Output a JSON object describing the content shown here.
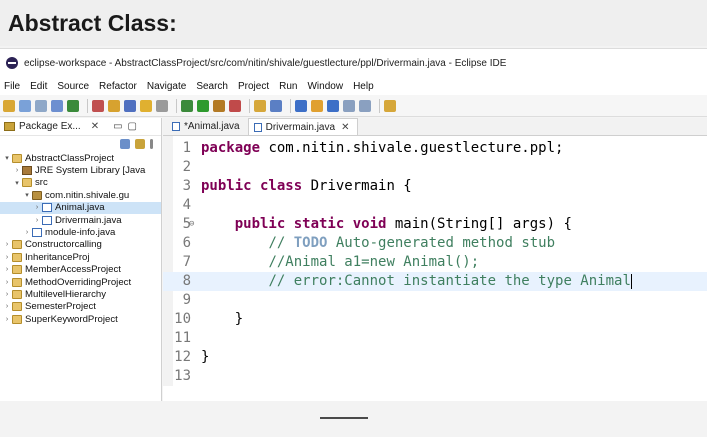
{
  "slide": {
    "title": "Abstract Class:"
  },
  "window": {
    "title": "eclipse-workspace - AbstractClassProject/src/com/nitin/shivale/guestlecture/ppl/Drivermain.java - Eclipse IDE"
  },
  "menu": [
    "File",
    "Edit",
    "Source",
    "Refactor",
    "Navigate",
    "Search",
    "Project",
    "Run",
    "Window",
    "Help"
  ],
  "explorer": {
    "tab_label": "Package Ex...",
    "tree": [
      {
        "indent": 0,
        "arrow": "▾",
        "icon": "project",
        "label": "AbstractClassProject"
      },
      {
        "indent": 1,
        "arrow": "›",
        "icon": "jre",
        "label": "JRE System Library [Java"
      },
      {
        "indent": 1,
        "arrow": "▾",
        "icon": "src",
        "label": "src"
      },
      {
        "indent": 2,
        "arrow": "▾",
        "icon": "pkg",
        "label": "com.nitin.shivale.gu"
      },
      {
        "indent": 3,
        "arrow": "›",
        "icon": "java",
        "label": "Animal.java",
        "selected": true
      },
      {
        "indent": 3,
        "arrow": "›",
        "icon": "java",
        "label": "Drivermain.java"
      },
      {
        "indent": 2,
        "arrow": "›",
        "icon": "java",
        "label": "module-info.java"
      },
      {
        "indent": 0,
        "arrow": "›",
        "icon": "project",
        "label": "Constructorcalling"
      },
      {
        "indent": 0,
        "arrow": "›",
        "icon": "project",
        "label": "InheritanceProj"
      },
      {
        "indent": 0,
        "arrow": "›",
        "icon": "project",
        "label": "MemberAccessProject"
      },
      {
        "indent": 0,
        "arrow": "›",
        "icon": "project",
        "label": "MethodOverridingProject"
      },
      {
        "indent": 0,
        "arrow": "›",
        "icon": "project",
        "label": "MultilevelHierarchy"
      },
      {
        "indent": 0,
        "arrow": "›",
        "icon": "project",
        "label": "SemesterProject"
      },
      {
        "indent": 0,
        "arrow": "›",
        "icon": "project",
        "label": "SuperKeywordProject"
      }
    ]
  },
  "editor": {
    "tabs": [
      {
        "label": "*Animal.java",
        "active": false
      },
      {
        "label": "Drivermain.java",
        "active": true
      }
    ],
    "lines": [
      {
        "n": "1",
        "parts": [
          {
            "t": "package",
            "c": "kw"
          },
          {
            "t": " com.nitin.shivale.guestlecture.ppl;"
          }
        ]
      },
      {
        "n": "2",
        "parts": []
      },
      {
        "n": "3",
        "parts": [
          {
            "t": "public class",
            "c": "kw"
          },
          {
            "t": " Drivermain {"
          }
        ]
      },
      {
        "n": "4",
        "parts": []
      },
      {
        "n": "5",
        "fold": "⊖",
        "parts": [
          {
            "t": "    "
          },
          {
            "t": "public static void",
            "c": "kw"
          },
          {
            "t": " main(String[] args) {"
          }
        ]
      },
      {
        "n": "6",
        "parts": [
          {
            "t": "        "
          },
          {
            "t": "// ",
            "c": "cm"
          },
          {
            "t": "TODO",
            "c": "todo"
          },
          {
            "t": " Auto-generated method stub",
            "c": "cm"
          }
        ]
      },
      {
        "n": "7",
        "parts": [
          {
            "t": "        "
          },
          {
            "t": "//Animal a1=new Animal();",
            "c": "cm"
          }
        ]
      },
      {
        "n": "8",
        "current": true,
        "caret": true,
        "parts": [
          {
            "t": "        "
          },
          {
            "t": "// error:Cannot instantiate the type Animal",
            "c": "cm"
          }
        ]
      },
      {
        "n": "9",
        "parts": []
      },
      {
        "n": "10",
        "parts": [
          {
            "t": "    }"
          }
        ]
      },
      {
        "n": "11",
        "parts": []
      },
      {
        "n": "12",
        "parts": [
          {
            "t": "}"
          }
        ]
      },
      {
        "n": "13",
        "parts": []
      }
    ]
  }
}
